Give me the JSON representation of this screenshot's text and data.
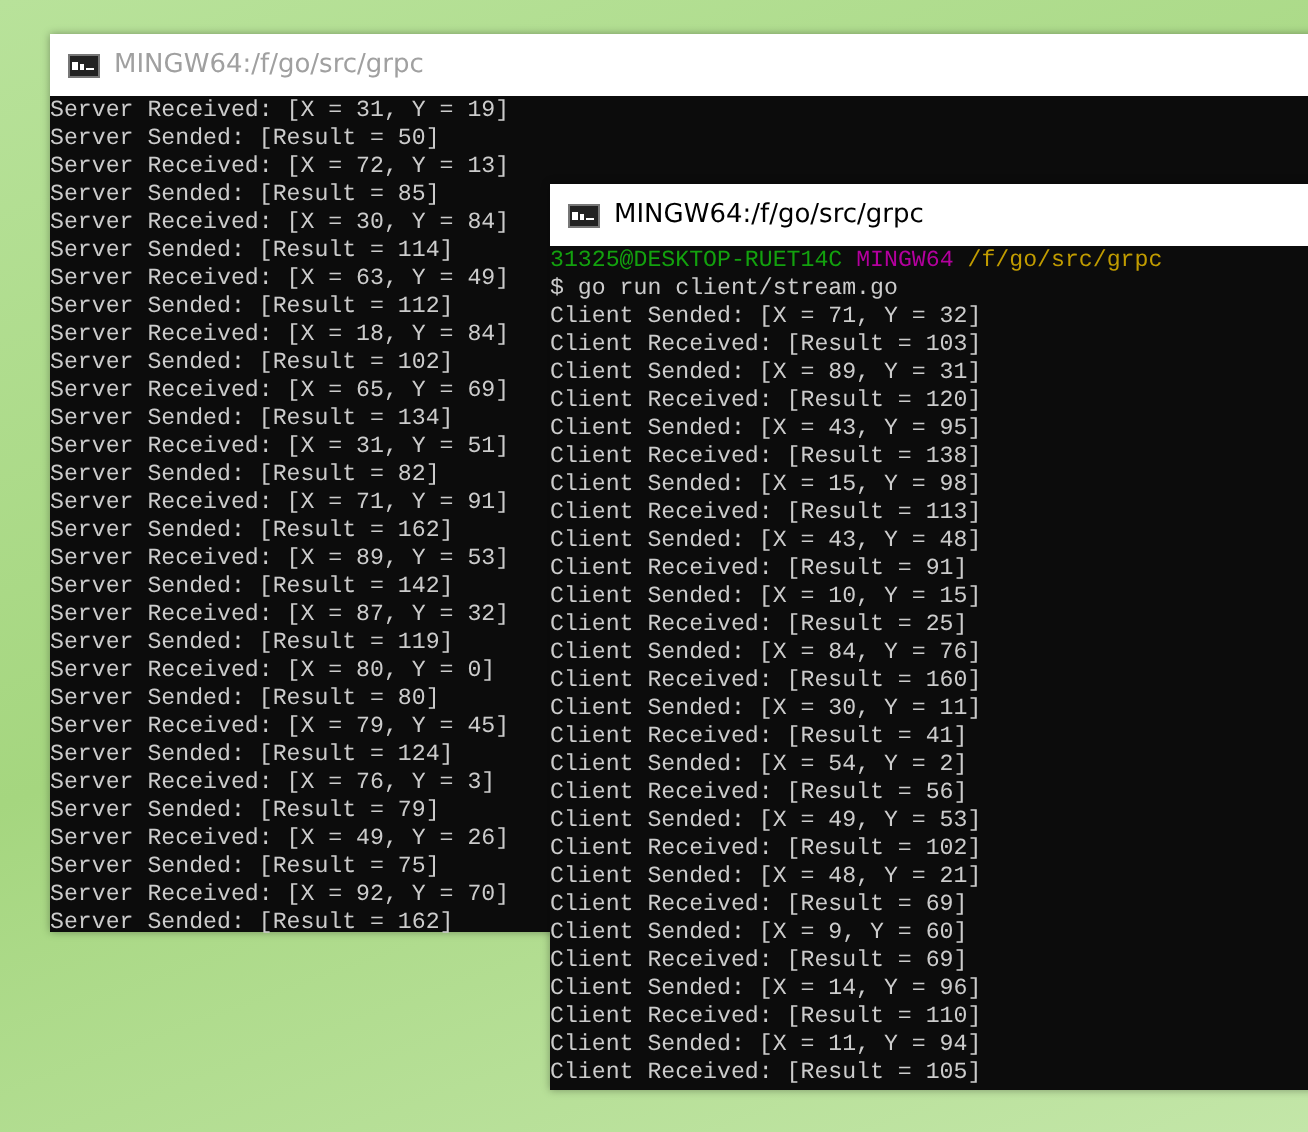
{
  "windows": [
    {
      "title": "MINGW64:/f/go/src/grpc",
      "selected": false,
      "lines": [
        "Server Received: [X = 31, Y = 19]",
        "Server Sended: [Result = 50]",
        "Server Received: [X = 72, Y = 13]",
        "Server Sended: [Result = 85]",
        "Server Received: [X = 30, Y = 84]",
        "Server Sended: [Result = 114]",
        "Server Received: [X = 63, Y = 49]",
        "Server Sended: [Result = 112]",
        "Server Received: [X = 18, Y = 84]",
        "Server Sended: [Result = 102]",
        "Server Received: [X = 65, Y = 69]",
        "Server Sended: [Result = 134]",
        "Server Received: [X = 31, Y = 51]",
        "Server Sended: [Result = 82]",
        "Server Received: [X = 71, Y = 91]",
        "Server Sended: [Result = 162]",
        "Server Received: [X = 89, Y = 53]",
        "Server Sended: [Result = 142]",
        "Server Received: [X = 87, Y = 32]",
        "Server Sended: [Result = 119]",
        "Server Received: [X = 80, Y = 0]",
        "Server Sended: [Result = 80]",
        "Server Received: [X = 79, Y = 45]",
        "Server Sended: [Result = 124]",
        "Server Received: [X = 76, Y = 3]",
        "Server Sended: [Result = 79]",
        "Server Received: [X = 49, Y = 26]",
        "Server Sended: [Result = 75]",
        "Server Received: [X = 92, Y = 70]",
        "Server Sended: [Result = 162]"
      ]
    },
    {
      "title": "MINGW64:/f/go/src/grpc",
      "selected": true,
      "prompt": [
        {
          "text": "31325@DESKTOP-RUET14C",
          "color": "#13a10e"
        },
        {
          "text": "MINGW64",
          "color": "#b4009e"
        },
        {
          "text": "/f/go/src/grpc",
          "color": "#c19c00"
        }
      ],
      "command": "$ go run client/stream.go",
      "lines": [
        "Client Sended: [X = 71, Y = 32]",
        "Client Received: [Result = 103]",
        "Client Sended: [X = 89, Y = 31]",
        "Client Received: [Result = 120]",
        "Client Sended: [X = 43, Y = 95]",
        "Client Received: [Result = 138]",
        "Client Sended: [X = 15, Y = 98]",
        "Client Received: [Result = 113]",
        "Client Sended: [X = 43, Y = 48]",
        "Client Received: [Result = 91]",
        "Client Sended: [X = 10, Y = 15]",
        "Client Received: [Result = 25]",
        "Client Sended: [X = 84, Y = 76]",
        "Client Received: [Result = 160]",
        "Client Sended: [X = 30, Y = 11]",
        "Client Received: [Result = 41]",
        "Client Sended: [X = 54, Y = 2]",
        "Client Received: [Result = 56]",
        "Client Sended: [X = 49, Y = 53]",
        "Client Received: [Result = 102]",
        "Client Sended: [X = 48, Y = 21]",
        "Client Received: [Result = 69]",
        "Client Sended: [X = 9, Y = 60]",
        "Client Received: [Result = 69]",
        "Client Sended: [X = 14, Y = 96]",
        "Client Received: [Result = 110]",
        "Client Sended: [X = 11, Y = 94]",
        "Client Received: [Result = 105]"
      ]
    }
  ]
}
